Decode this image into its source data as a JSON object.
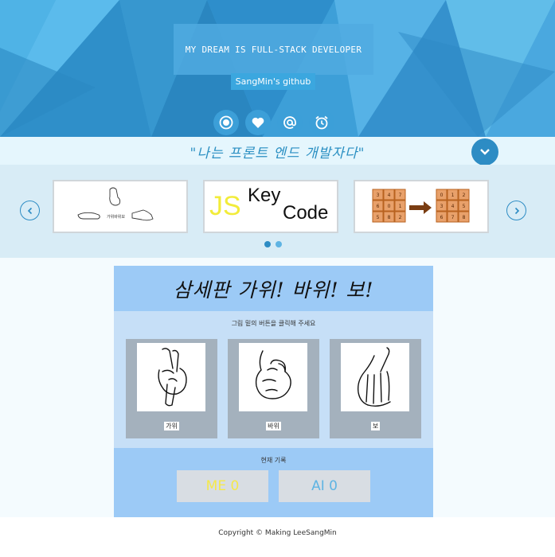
{
  "hero": {
    "title": "My Dream is Full-Stack Developer",
    "link_label": "SangMin's github",
    "icons": [
      "record-icon",
      "heart-icon",
      "at-icon",
      "alarm-clock-icon"
    ]
  },
  "slogan": "\"나는 프론트 엔드 개발자다\"",
  "carousel": {
    "slides": [
      {
        "caption": "가위바위보"
      },
      {
        "js": "JS",
        "line1": "Key",
        "line2": "Code"
      },
      {
        "grid_left": [
          "3",
          "4",
          "7",
          "6",
          "0",
          "1",
          "5",
          "8",
          "2"
        ],
        "grid_right": [
          "0",
          "1",
          "2",
          "3",
          "4",
          "5",
          "6",
          "7",
          "8"
        ]
      }
    ],
    "active_dot": 0
  },
  "game": {
    "title": "삼세판 가위! 바위! 보!",
    "instruction": "그림 밑의 버튼을 클릭해 주세요",
    "choices": [
      {
        "label": "가위"
      },
      {
        "label": "바위"
      },
      {
        "label": "보"
      }
    ],
    "record_label": "현재 기록",
    "me_score": "ME 0",
    "ai_score": "AI 0"
  },
  "footer": {
    "copyright": "Copyright © Making LeeSangMin"
  },
  "colors": {
    "primary": "#2d8cc4",
    "hero_bg": "#3a9fd6",
    "game_header": "#9ccaf6",
    "me_color": "#f5e94a",
    "ai_color": "#5fb4e3"
  }
}
